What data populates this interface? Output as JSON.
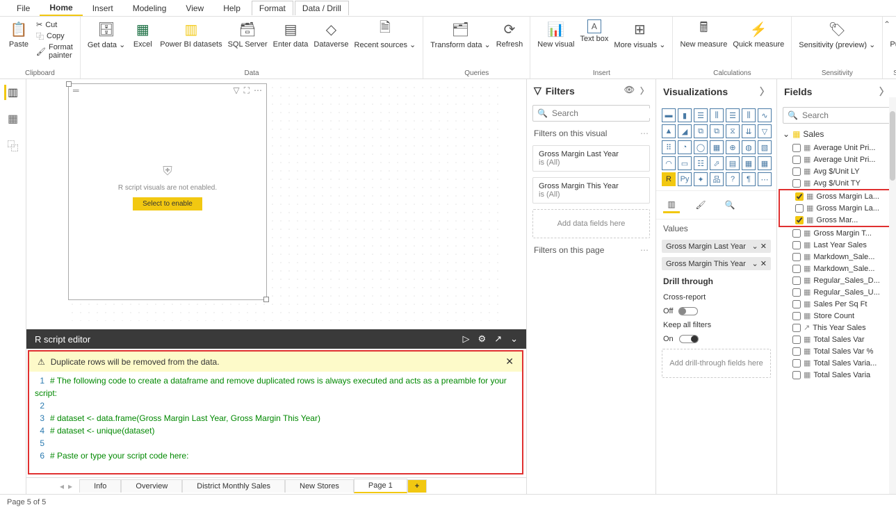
{
  "menu": {
    "file": "File",
    "home": "Home",
    "insert": "Insert",
    "modeling": "Modeling",
    "view": "View",
    "help": "Help",
    "format": "Format",
    "datadrill": "Data / Drill"
  },
  "ribbon": {
    "clipboard": {
      "label": "Clipboard",
      "paste": "Paste",
      "cut": "Cut",
      "copy": "Copy",
      "fmt": "Format painter"
    },
    "data": {
      "label": "Data",
      "get": "Get data",
      "excel": "Excel",
      "pbi": "Power BI datasets",
      "sql": "SQL Server",
      "enter": "Enter data",
      "dv": "Dataverse",
      "recent": "Recent sources"
    },
    "queries": {
      "label": "Queries",
      "transform": "Transform data",
      "refresh": "Refresh"
    },
    "insert": {
      "label": "Insert",
      "newv": "New visual",
      "text": "Text box",
      "more": "More visuals"
    },
    "calc": {
      "label": "Calculations",
      "newm": "New measure",
      "quick": "Quick measure"
    },
    "sens": {
      "label": "Sensitivity",
      "btn": "Sensitivity (preview)"
    },
    "share": {
      "label": "Share",
      "pub": "Publish"
    }
  },
  "visual": {
    "msg": "R script visuals are not enabled.",
    "btn": "Select to enable"
  },
  "r": {
    "title": "R script editor",
    "warn": "Duplicate rows will be removed from the data.",
    "l1": "# The following code to create a dataframe and remove duplicated rows is always executed and acts as a preamble for your script:",
    "l3": "# dataset <- data.frame(Gross Margin Last Year, Gross Margin This Year)",
    "l4": "# dataset <- unique(dataset)",
    "l6": "# Paste or type your script code here:"
  },
  "tabs": {
    "info": "Info",
    "overview": "Overview",
    "district": "District Monthly Sales",
    "newstores": "New Stores",
    "page1": "Page 1"
  },
  "status": "Page 5 of 5",
  "filters": {
    "title": "Filters",
    "search": "Search",
    "onvisual": "Filters on this visual",
    "f1a": "Gross Margin Last Year",
    "f1b": "is (All)",
    "f2a": "Gross Margin This Year",
    "f2b": "is (All)",
    "add": "Add data fields here",
    "onpage": "Filters on this page"
  },
  "viz": {
    "title": "Visualizations",
    "values": "Values",
    "v1": "Gross Margin Last Year",
    "v2": "Gross Margin This Year",
    "drill": "Drill through",
    "cross": "Cross-report",
    "off": "Off",
    "keep": "Keep all filters",
    "on": "On",
    "adddrill": "Add drill-through fields here"
  },
  "fields": {
    "title": "Fields",
    "search": "Search",
    "group": "Sales",
    "items": [
      "Average Unit Pri...",
      "Average Unit Pri...",
      "Avg $/Unit LY",
      "Avg $/Unit TY",
      "Gross Margin La...",
      "Gross Margin La...",
      "Gross Mar...",
      "Gross Margin T...",
      "Last Year Sales",
      "Markdown_Sale...",
      "Markdown_Sale...",
      "Regular_Sales_D...",
      "Regular_Sales_U...",
      "Sales Per Sq Ft",
      "Store Count",
      "This Year Sales",
      "Total Sales Var",
      "Total Sales Var %",
      "Total Sales Varia...",
      "Total Sales Varia"
    ]
  }
}
